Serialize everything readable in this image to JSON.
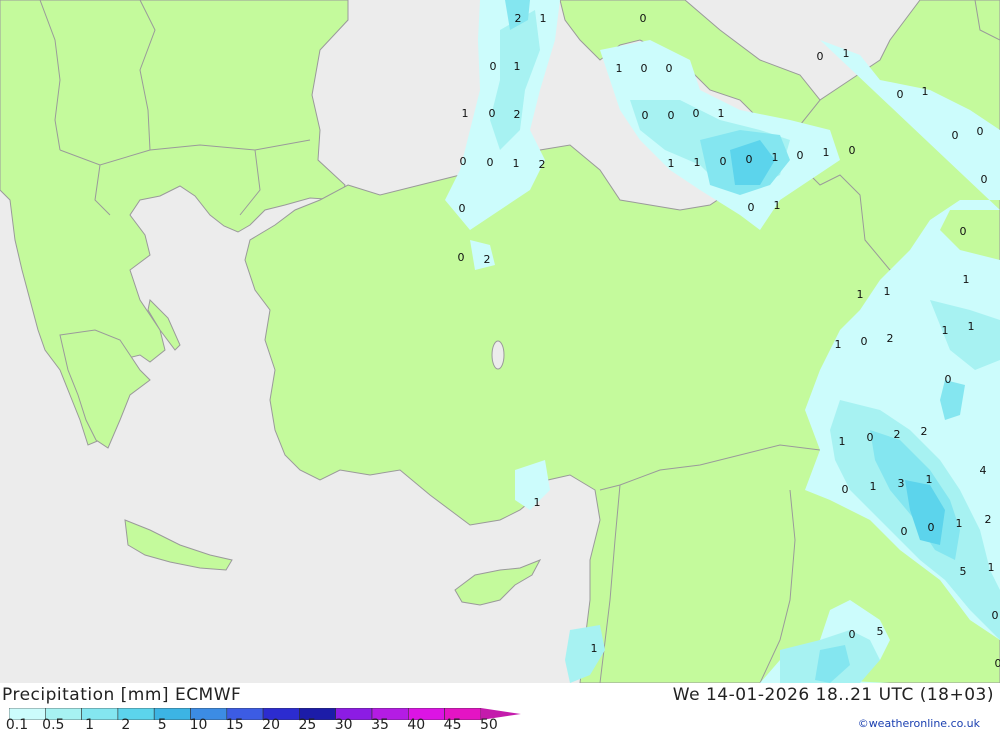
{
  "header": {
    "title": "Precipitation [mm] ECMWF",
    "datetime": "We 14-01-2026 18..21 UTC (18+03)"
  },
  "legend": {
    "labels": [
      "0.1",
      "0.5",
      "1",
      "2",
      "5",
      "10",
      "15",
      "20",
      "25",
      "30",
      "35",
      "40",
      "45",
      "50"
    ],
    "colors": [
      "#ccfcfc",
      "#a7f2f2",
      "#84e6f0",
      "#5cd4ec",
      "#3cb4e4",
      "#3c8ce4",
      "#3c5ce4",
      "#2c2cd0",
      "#1c1ca8",
      "#8c1ce4",
      "#b41ce4",
      "#dc14e4",
      "#e414c4",
      "#c41cac"
    ]
  },
  "credit": "©weatheronline.co.uk",
  "colors": {
    "land": "#c4fa9c",
    "sea": "#ececec",
    "border": "#9a9a9a"
  },
  "map_values": [
    {
      "text": "2"
    },
    {
      "text": "1"
    },
    {
      "text": "0"
    },
    {
      "text": "0"
    },
    {
      "text": "1"
    },
    {
      "text": "0"
    },
    {
      "text": "1"
    },
    {
      "text": "1"
    },
    {
      "text": "0"
    },
    {
      "text": "0"
    },
    {
      "text": "0"
    },
    {
      "text": "1"
    },
    {
      "text": "1"
    },
    {
      "text": "0"
    },
    {
      "text": "2"
    },
    {
      "text": "0"
    },
    {
      "text": "0"
    },
    {
      "text": "0"
    },
    {
      "text": "1"
    },
    {
      "text": "0"
    },
    {
      "text": "0"
    },
    {
      "text": "0"
    },
    {
      "text": "0"
    },
    {
      "text": "1"
    },
    {
      "text": "2"
    },
    {
      "text": "1"
    },
    {
      "text": "1"
    },
    {
      "text": "0"
    },
    {
      "text": "0"
    },
    {
      "text": "1"
    },
    {
      "text": "0"
    },
    {
      "text": "1"
    },
    {
      "text": "0"
    },
    {
      "text": "0"
    },
    {
      "text": "0"
    },
    {
      "text": "0"
    },
    {
      "text": "1"
    },
    {
      "text": "0"
    },
    {
      "text": "0"
    },
    {
      "text": "2"
    },
    {
      "text": "1"
    },
    {
      "text": "1"
    },
    {
      "text": "1"
    },
    {
      "text": "1"
    },
    {
      "text": "1"
    },
    {
      "text": "1"
    },
    {
      "text": "0"
    },
    {
      "text": "2"
    },
    {
      "text": "0"
    },
    {
      "text": "1"
    },
    {
      "text": "0"
    },
    {
      "text": "2"
    },
    {
      "text": "2"
    },
    {
      "text": "4"
    },
    {
      "text": "0"
    },
    {
      "text": "1"
    },
    {
      "text": "3"
    },
    {
      "text": "1"
    },
    {
      "text": "1"
    },
    {
      "text": "2"
    },
    {
      "text": "1"
    },
    {
      "text": "0"
    },
    {
      "text": "0"
    },
    {
      "text": "5"
    },
    {
      "text": "1"
    },
    {
      "text": "0"
    }
  ]
}
